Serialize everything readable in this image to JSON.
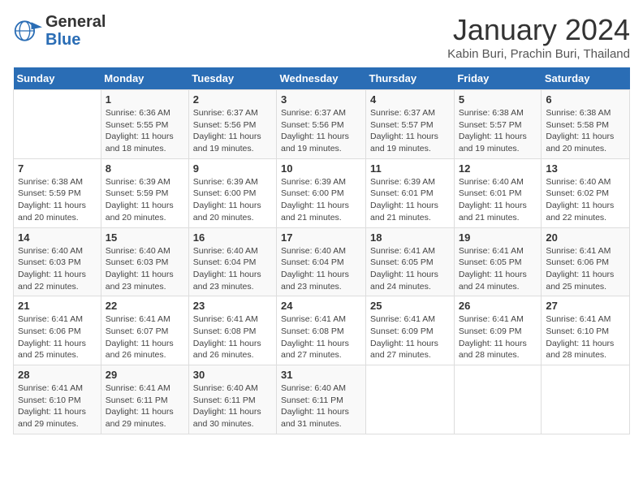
{
  "logo": {
    "general": "General",
    "blue": "Blue"
  },
  "title": "January 2024",
  "subtitle": "Kabin Buri, Prachin Buri, Thailand",
  "days_of_week": [
    "Sunday",
    "Monday",
    "Tuesday",
    "Wednesday",
    "Thursday",
    "Friday",
    "Saturday"
  ],
  "weeks": [
    [
      {
        "day": "",
        "sunrise": "",
        "sunset": "",
        "daylight": ""
      },
      {
        "day": "1",
        "sunrise": "Sunrise: 6:36 AM",
        "sunset": "Sunset: 5:55 PM",
        "daylight": "Daylight: 11 hours and 18 minutes."
      },
      {
        "day": "2",
        "sunrise": "Sunrise: 6:37 AM",
        "sunset": "Sunset: 5:56 PM",
        "daylight": "Daylight: 11 hours and 19 minutes."
      },
      {
        "day": "3",
        "sunrise": "Sunrise: 6:37 AM",
        "sunset": "Sunset: 5:56 PM",
        "daylight": "Daylight: 11 hours and 19 minutes."
      },
      {
        "day": "4",
        "sunrise": "Sunrise: 6:37 AM",
        "sunset": "Sunset: 5:57 PM",
        "daylight": "Daylight: 11 hours and 19 minutes."
      },
      {
        "day": "5",
        "sunrise": "Sunrise: 6:38 AM",
        "sunset": "Sunset: 5:57 PM",
        "daylight": "Daylight: 11 hours and 19 minutes."
      },
      {
        "day": "6",
        "sunrise": "Sunrise: 6:38 AM",
        "sunset": "Sunset: 5:58 PM",
        "daylight": "Daylight: 11 hours and 20 minutes."
      }
    ],
    [
      {
        "day": "7",
        "sunrise": "Sunrise: 6:38 AM",
        "sunset": "Sunset: 5:59 PM",
        "daylight": "Daylight: 11 hours and 20 minutes."
      },
      {
        "day": "8",
        "sunrise": "Sunrise: 6:39 AM",
        "sunset": "Sunset: 5:59 PM",
        "daylight": "Daylight: 11 hours and 20 minutes."
      },
      {
        "day": "9",
        "sunrise": "Sunrise: 6:39 AM",
        "sunset": "Sunset: 6:00 PM",
        "daylight": "Daylight: 11 hours and 20 minutes."
      },
      {
        "day": "10",
        "sunrise": "Sunrise: 6:39 AM",
        "sunset": "Sunset: 6:00 PM",
        "daylight": "Daylight: 11 hours and 21 minutes."
      },
      {
        "day": "11",
        "sunrise": "Sunrise: 6:39 AM",
        "sunset": "Sunset: 6:01 PM",
        "daylight": "Daylight: 11 hours and 21 minutes."
      },
      {
        "day": "12",
        "sunrise": "Sunrise: 6:40 AM",
        "sunset": "Sunset: 6:01 PM",
        "daylight": "Daylight: 11 hours and 21 minutes."
      },
      {
        "day": "13",
        "sunrise": "Sunrise: 6:40 AM",
        "sunset": "Sunset: 6:02 PM",
        "daylight": "Daylight: 11 hours and 22 minutes."
      }
    ],
    [
      {
        "day": "14",
        "sunrise": "Sunrise: 6:40 AM",
        "sunset": "Sunset: 6:03 PM",
        "daylight": "Daylight: 11 hours and 22 minutes."
      },
      {
        "day": "15",
        "sunrise": "Sunrise: 6:40 AM",
        "sunset": "Sunset: 6:03 PM",
        "daylight": "Daylight: 11 hours and 23 minutes."
      },
      {
        "day": "16",
        "sunrise": "Sunrise: 6:40 AM",
        "sunset": "Sunset: 6:04 PM",
        "daylight": "Daylight: 11 hours and 23 minutes."
      },
      {
        "day": "17",
        "sunrise": "Sunrise: 6:40 AM",
        "sunset": "Sunset: 6:04 PM",
        "daylight": "Daylight: 11 hours and 23 minutes."
      },
      {
        "day": "18",
        "sunrise": "Sunrise: 6:41 AM",
        "sunset": "Sunset: 6:05 PM",
        "daylight": "Daylight: 11 hours and 24 minutes."
      },
      {
        "day": "19",
        "sunrise": "Sunrise: 6:41 AM",
        "sunset": "Sunset: 6:05 PM",
        "daylight": "Daylight: 11 hours and 24 minutes."
      },
      {
        "day": "20",
        "sunrise": "Sunrise: 6:41 AM",
        "sunset": "Sunset: 6:06 PM",
        "daylight": "Daylight: 11 hours and 25 minutes."
      }
    ],
    [
      {
        "day": "21",
        "sunrise": "Sunrise: 6:41 AM",
        "sunset": "Sunset: 6:06 PM",
        "daylight": "Daylight: 11 hours and 25 minutes."
      },
      {
        "day": "22",
        "sunrise": "Sunrise: 6:41 AM",
        "sunset": "Sunset: 6:07 PM",
        "daylight": "Daylight: 11 hours and 26 minutes."
      },
      {
        "day": "23",
        "sunrise": "Sunrise: 6:41 AM",
        "sunset": "Sunset: 6:08 PM",
        "daylight": "Daylight: 11 hours and 26 minutes."
      },
      {
        "day": "24",
        "sunrise": "Sunrise: 6:41 AM",
        "sunset": "Sunset: 6:08 PM",
        "daylight": "Daylight: 11 hours and 27 minutes."
      },
      {
        "day": "25",
        "sunrise": "Sunrise: 6:41 AM",
        "sunset": "Sunset: 6:09 PM",
        "daylight": "Daylight: 11 hours and 27 minutes."
      },
      {
        "day": "26",
        "sunrise": "Sunrise: 6:41 AM",
        "sunset": "Sunset: 6:09 PM",
        "daylight": "Daylight: 11 hours and 28 minutes."
      },
      {
        "day": "27",
        "sunrise": "Sunrise: 6:41 AM",
        "sunset": "Sunset: 6:10 PM",
        "daylight": "Daylight: 11 hours and 28 minutes."
      }
    ],
    [
      {
        "day": "28",
        "sunrise": "Sunrise: 6:41 AM",
        "sunset": "Sunset: 6:10 PM",
        "daylight": "Daylight: 11 hours and 29 minutes."
      },
      {
        "day": "29",
        "sunrise": "Sunrise: 6:41 AM",
        "sunset": "Sunset: 6:11 PM",
        "daylight": "Daylight: 11 hours and 29 minutes."
      },
      {
        "day": "30",
        "sunrise": "Sunrise: 6:40 AM",
        "sunset": "Sunset: 6:11 PM",
        "daylight": "Daylight: 11 hours and 30 minutes."
      },
      {
        "day": "31",
        "sunrise": "Sunrise: 6:40 AM",
        "sunset": "Sunset: 6:11 PM",
        "daylight": "Daylight: 11 hours and 31 minutes."
      },
      {
        "day": "",
        "sunrise": "",
        "sunset": "",
        "daylight": ""
      },
      {
        "day": "",
        "sunrise": "",
        "sunset": "",
        "daylight": ""
      },
      {
        "day": "",
        "sunrise": "",
        "sunset": "",
        "daylight": ""
      }
    ]
  ]
}
